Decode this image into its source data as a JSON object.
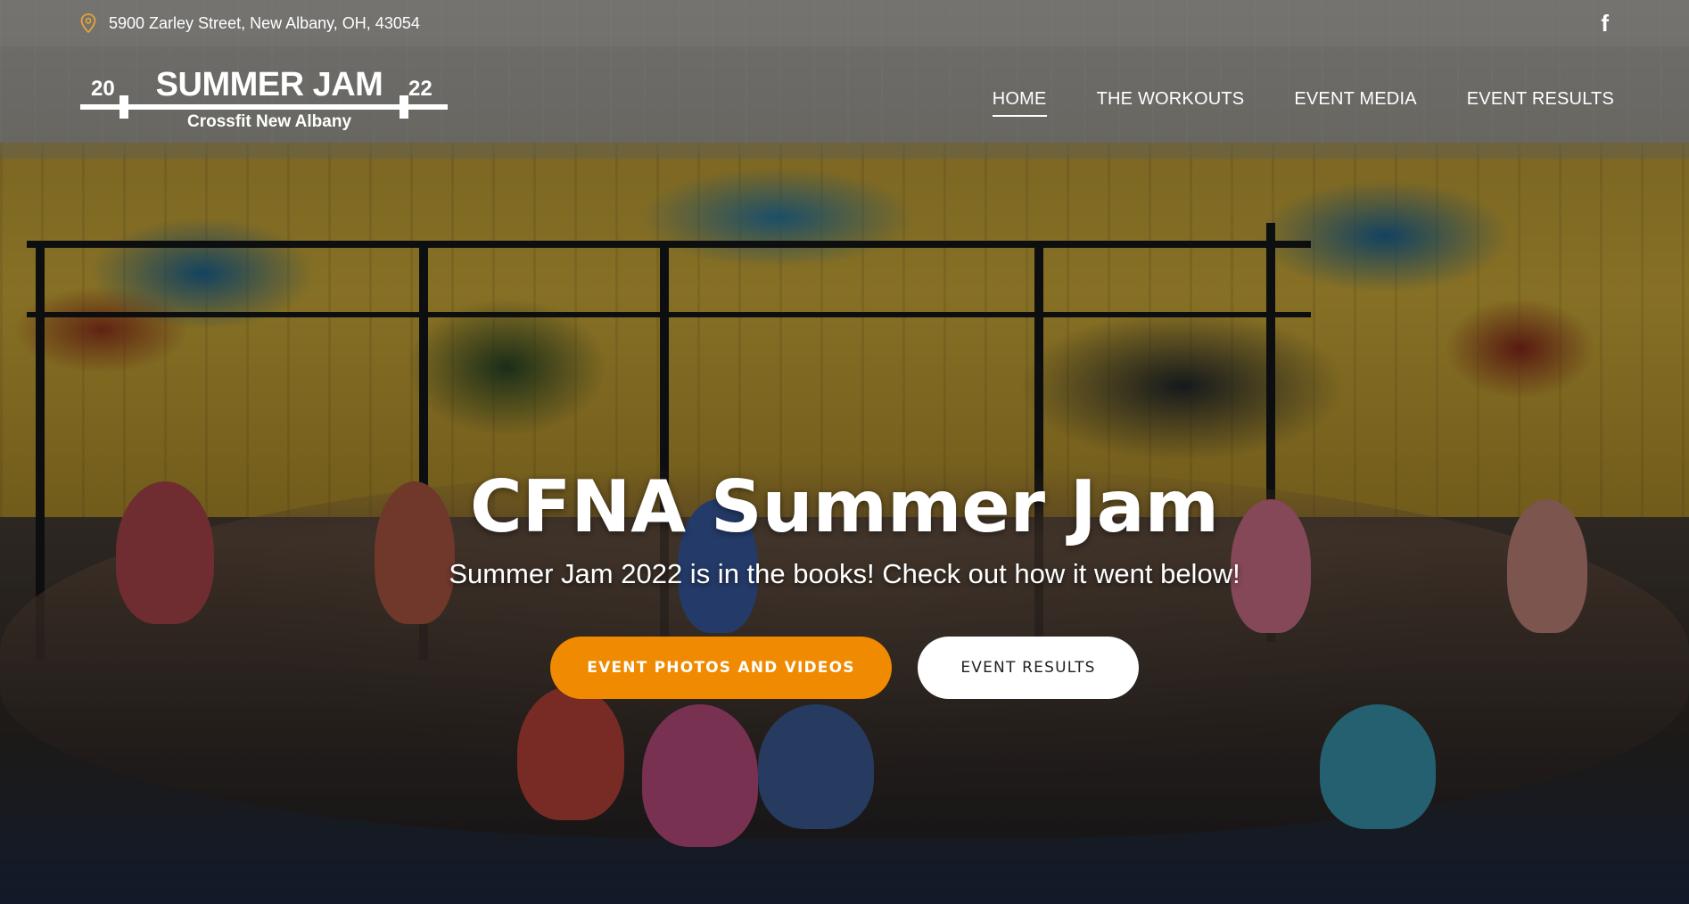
{
  "topbar": {
    "address": "5900 Zarley Street, New Albany, OH, 43054",
    "location_icon": "map-pin-icon",
    "social_icon": "facebook-icon",
    "social_glyph": "f"
  },
  "logo": {
    "year_left": "20",
    "year_right": "22",
    "title": "SUMMER JAM",
    "subtitle": "Crossfit New Albany"
  },
  "nav": {
    "items": [
      {
        "label": "HOME",
        "active": true
      },
      {
        "label": "THE WORKOUTS",
        "active": false
      },
      {
        "label": "EVENT MEDIA",
        "active": false
      },
      {
        "label": "EVENT RESULTS",
        "active": false
      }
    ]
  },
  "hero": {
    "title": "CFNA Summer Jam",
    "subtitle": "Summer Jam 2022 is in the books!  Check out how it went below!",
    "primary_button": "EVENT PHOTOS AND VIDEOS",
    "secondary_button": "EVENT RESULTS"
  },
  "colors": {
    "accent": "#f08a00",
    "pin": "#e8a23a"
  }
}
